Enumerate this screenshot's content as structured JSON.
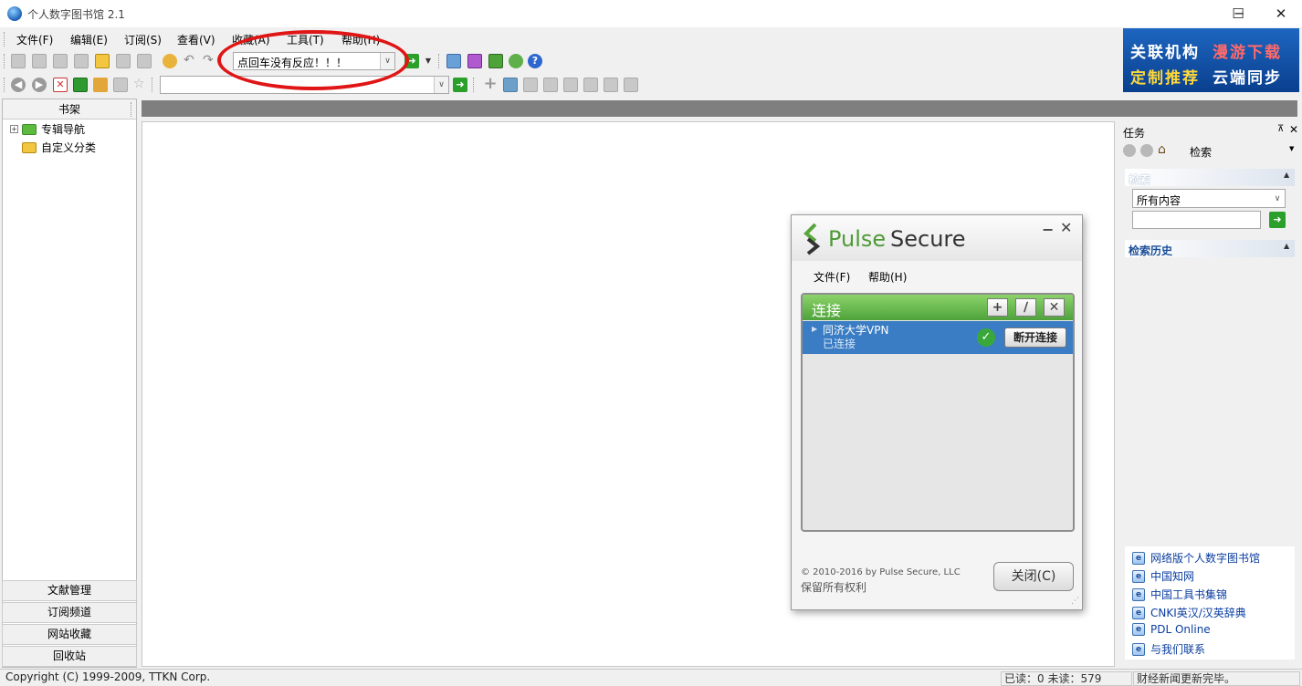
{
  "window": {
    "title": "个人数字图书馆 2.1",
    "minimize": "─",
    "maximize": "☐",
    "close": "✕"
  },
  "menu": [
    "文件(F)",
    "编辑(E)",
    "订阅(S)",
    "查看(V)",
    "收藏(A)",
    "工具(T)",
    "帮助(H)"
  ],
  "toolbar": {
    "search_value": "点回车没有反应！！！",
    "address_value": ""
  },
  "banner": {
    "line1a": "关联机构",
    "line1b": "漫游下载",
    "line2a": "定制推荐",
    "line2b": "云端同步"
  },
  "left_panel": {
    "title": "书架",
    "tree": [
      "专辑导航",
      "自定义分类"
    ],
    "tabs": [
      "文献管理",
      "订阅频道",
      "网站收藏",
      "回收站"
    ]
  },
  "task_pane": {
    "title": "任务",
    "pin": "⊼",
    "close": "✕",
    "nav_label": "检索",
    "search_section": "检索",
    "search_scope": "所有内容",
    "search_input": "",
    "history_section": "检索历史",
    "links": [
      "网络版个人数字图书馆",
      "中国知网",
      "中国工具书集锦",
      "CNKI英汉/汉英辞典",
      "PDL Online",
      "与我们联系"
    ]
  },
  "pulse": {
    "brand_a": "Pulse",
    "brand_b": "Secure",
    "min": "−",
    "close": "✕",
    "menu": [
      "文件(F)",
      "帮助(H)"
    ],
    "section": "连接",
    "btn_add": "+",
    "btn_edit": "∕",
    "btn_del": "✕",
    "connection": {
      "name": "同济大学VPN",
      "status": "已连接",
      "action": "断开连接"
    },
    "copyright": "© 2010-2016 by Pulse Secure, LLC",
    "rights": "保留所有权利",
    "close_label": "关闭(C)"
  },
  "status": {
    "copyright": "Copyright (C) 1999-2009, TTKN Corp.",
    "counts": "已读：0 未读：579",
    "message": "财经新闻更新完毕。"
  },
  "colors": {
    "accent_green": "#4ea23a",
    "selection_blue": "#3a7dc4",
    "annotation_red": "#e01515",
    "banner_blue": "#0a3f8e"
  }
}
